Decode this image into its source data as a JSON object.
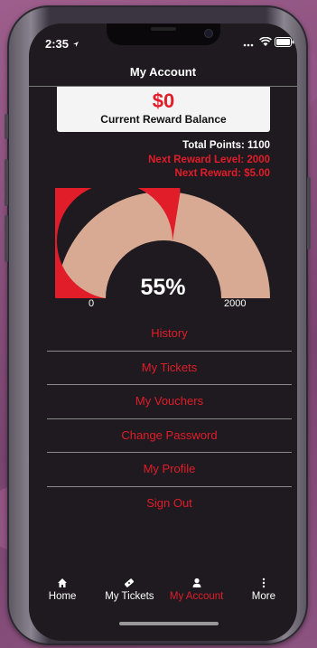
{
  "status_bar": {
    "time": "2:35"
  },
  "header": {
    "title": "My Account"
  },
  "balance": {
    "amount": "$0",
    "label": "Current Reward Balance"
  },
  "stats": {
    "total_points": "Total Points: 1100",
    "next_level": "Next Reward Level: 2000",
    "next_reward": "Next Reward: $5.00"
  },
  "gauge": {
    "percent_label": "55%",
    "percent_value": 0.55,
    "min_label": "0",
    "max_label": "2000",
    "fill_color": "#e11d2a",
    "remaining_color": "#d8a993"
  },
  "menu": {
    "items": [
      {
        "label": "History"
      },
      {
        "label": "My Tickets"
      },
      {
        "label": "My Vouchers"
      },
      {
        "label": "Change Password"
      },
      {
        "label": "My Profile"
      },
      {
        "label": "Sign Out"
      }
    ]
  },
  "tabs": [
    {
      "label": "Home",
      "icon": "home-icon"
    },
    {
      "label": "My Tickets",
      "icon": "ticket-icon"
    },
    {
      "label": "My Account",
      "icon": "user-icon",
      "active": true
    },
    {
      "label": "More",
      "icon": "more-icon"
    }
  ],
  "colors": {
    "accent": "#e11d2a",
    "background": "#1e1a1f"
  }
}
